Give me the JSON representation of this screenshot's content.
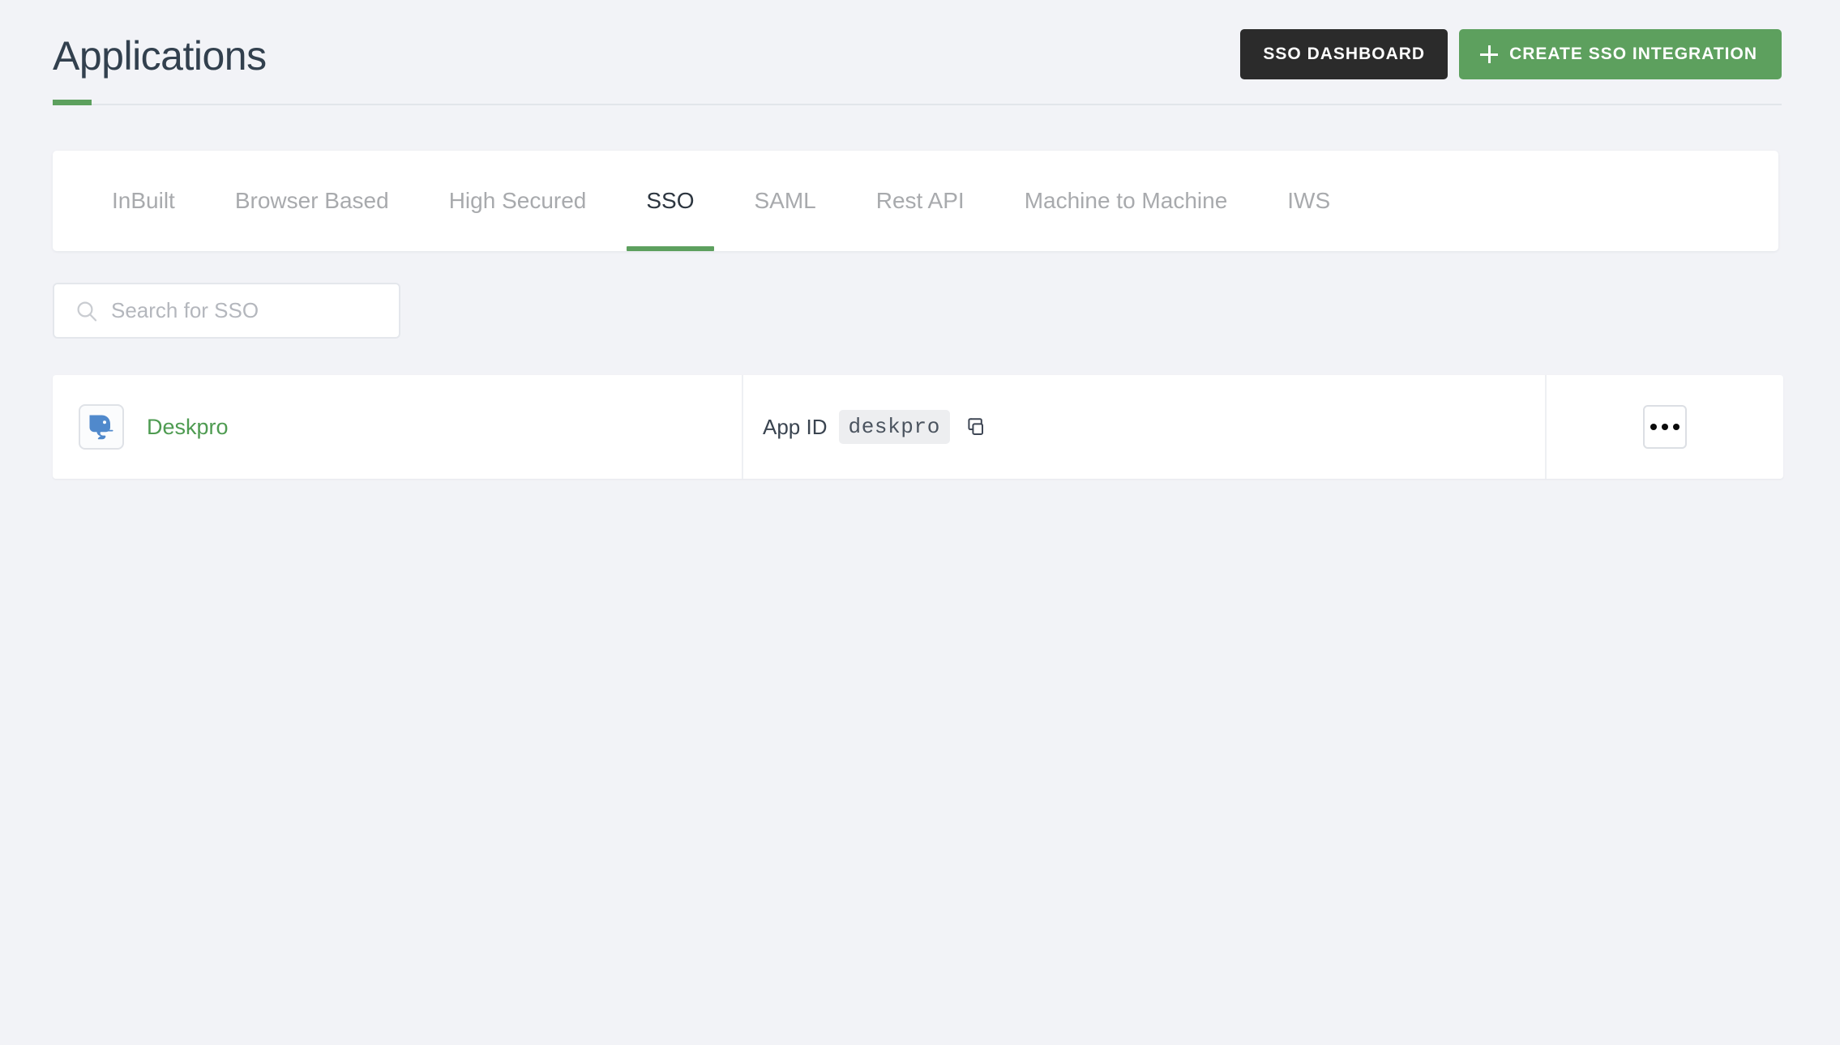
{
  "header": {
    "title": "Applications",
    "accent_color": "#5da05e",
    "actions": [
      {
        "id": "sso-dashboard",
        "label": "SSO DASHBOARD",
        "style": "dark",
        "icon": null
      },
      {
        "id": "create-sso-integration",
        "label": "CREATE SSO INTEGRATION",
        "style": "green",
        "icon": "plus-icon"
      }
    ]
  },
  "tabs": {
    "active": "SSO",
    "items": [
      {
        "label": "InBuilt"
      },
      {
        "label": "Browser Based"
      },
      {
        "label": "High Secured"
      },
      {
        "label": "SSO"
      },
      {
        "label": "SAML"
      },
      {
        "label": "Rest API"
      },
      {
        "label": "Machine to Machine"
      },
      {
        "label": "IWS"
      }
    ]
  },
  "search": {
    "placeholder": "Search for SSO",
    "value": "",
    "icon": "search-icon"
  },
  "list": {
    "rows": [
      {
        "app_name": "Deskpro",
        "app_logo": "deskpro-elephant-logo",
        "appid_label": "App ID",
        "appid_value": "deskpro",
        "copy_icon": "copy-icon",
        "actions_icon": "kebab-menu-icon"
      }
    ]
  },
  "colors": {
    "background": "#f2f3f7",
    "accent_green": "#5da05e",
    "link_green": "#4e9b51",
    "dark_button": "#2b2b2b",
    "title_text": "#32404e",
    "tab_inactive": "#a8aaad",
    "brand_blue": "#5089cc"
  }
}
